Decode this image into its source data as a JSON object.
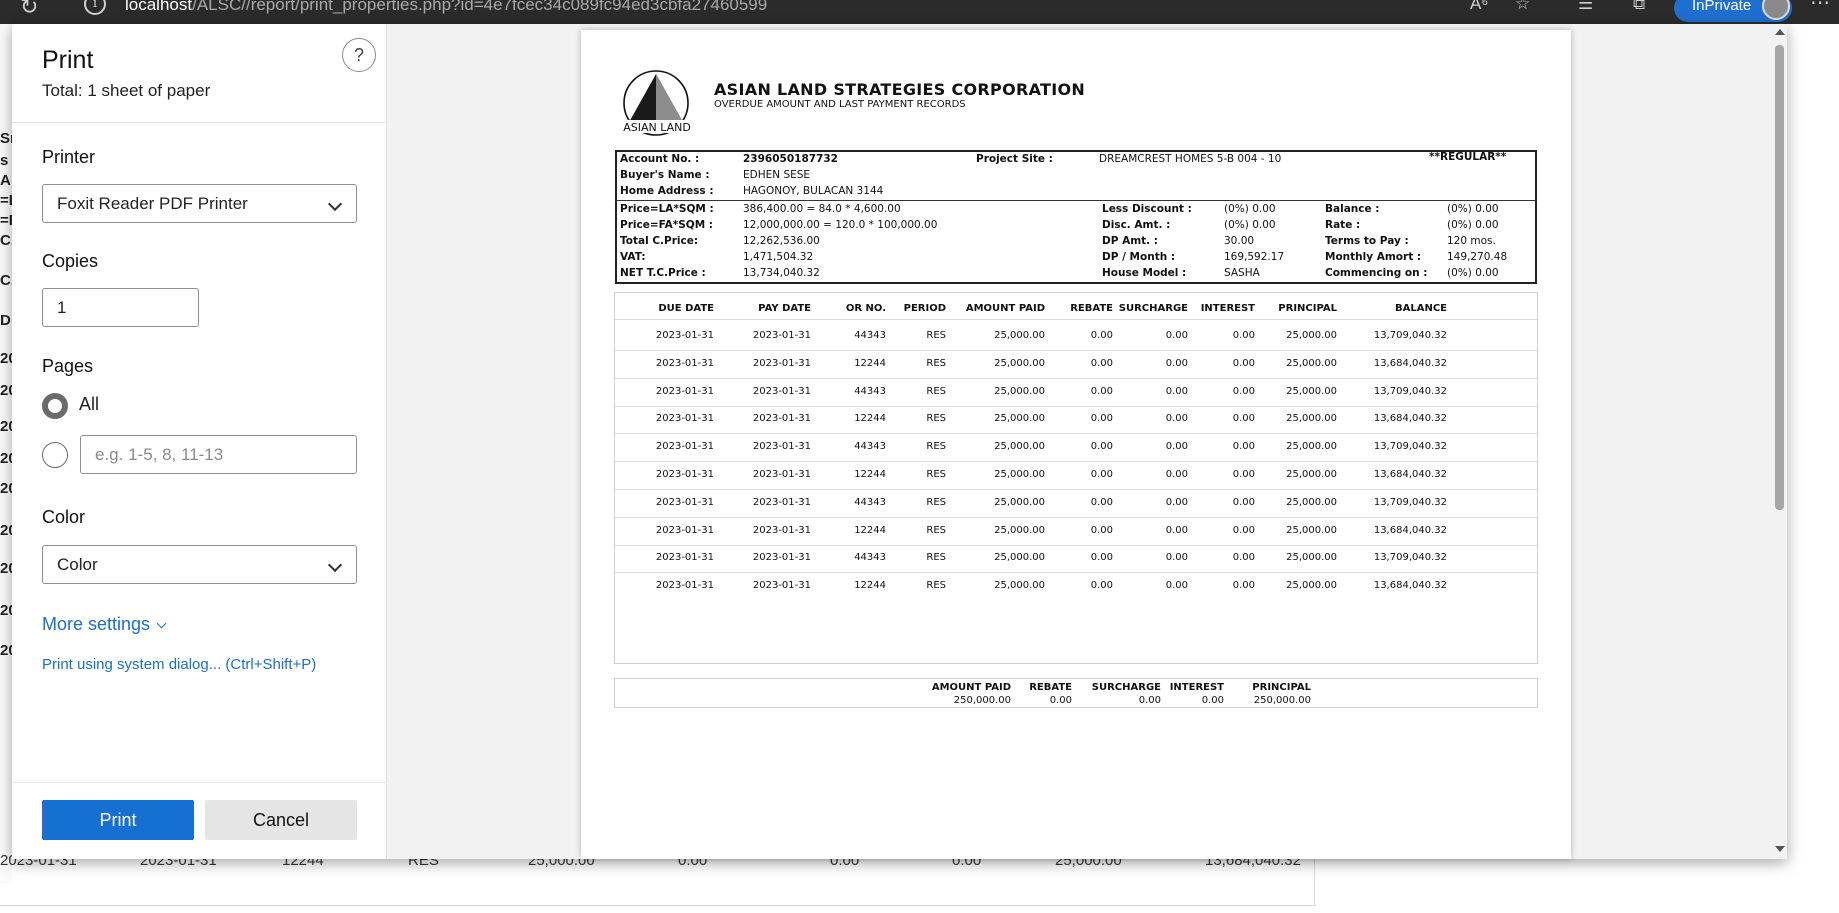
{
  "browser": {
    "url_host": "localhost",
    "url_path": "/ALSC//report/print_properties.php?id=4e7fcec34c089fc94ed3cbfa27460599",
    "inprivate_label": "InPrivate"
  },
  "background_page": {
    "left_fragments": [
      "Sn",
      "s",
      "A",
      "=L",
      "=F",
      "C.",
      "C.",
      "D",
      "20",
      "20",
      "20",
      "20",
      "20",
      "20",
      "20",
      "20",
      "20"
    ],
    "partial_row": [
      "2023-01-31",
      "2023-01-31",
      "12244",
      "RES",
      "25,000.00",
      "0.00",
      "0.00",
      "0.00",
      "25,000.00",
      "13,684,040.32"
    ]
  },
  "print_panel": {
    "title": "Print",
    "total": "Total: 1 sheet of paper",
    "help_icon": "?",
    "printer_label": "Printer",
    "printer_value": "Foxit Reader PDF Printer",
    "copies_label": "Copies",
    "copies_value": "1",
    "pages_label": "Pages",
    "pages_all": "All",
    "pages_placeholder": "e.g. 1-5, 8, 11-13",
    "color_label": "Color",
    "color_value": "Color",
    "more_settings": "More settings",
    "system_dialog": "Print using system dialog... (Ctrl+Shift+P)",
    "print_button": "Print",
    "cancel_button": "Cancel"
  },
  "report": {
    "company": "ASIAN LAND STRATEGIES CORPORATION",
    "subtitle": "OVERDUE AMOUNT AND LAST PAYMENT RECORDS",
    "logo_text": "ASIAN LAND",
    "account_label": "Account No. :",
    "account_value": "2396050187732",
    "project_label": "Project Site :",
    "project_value": "DREAMCREST HOMES 5-B 004 - 10",
    "regular_tag": "**REGULAR**",
    "buyer_label": "Buyer's Name :",
    "buyer_value": "EDHEN SESE",
    "address_label": "Home Address :",
    "address_value": "HAGONOY, BULACAN 3144",
    "price_la_label": "Price=LA*SQM :",
    "price_la_value": "386,400.00 = 84.0 * 4,600.00",
    "price_fa_label": "Price=FA*SQM :",
    "price_fa_value": "12,000,000.00 = 120.0 * 100,000.00",
    "total_cprice_label": "Total C.Price:",
    "total_cprice_value": "12,262,536.00",
    "vat_label": "VAT:",
    "vat_value": "1,471,504.32",
    "net_label": "NET T.C.Price :",
    "net_value": "13,734,040.32",
    "less_discount_label": "Less Discount :",
    "less_discount_value": "(0%) 0.00",
    "disc_amt_label": "Disc. Amt. :",
    "disc_amt_value": "(0%) 0.00",
    "dp_amt_label": "DP Amt. :",
    "dp_amt_value": "30.00",
    "dp_month_label": "DP / Month :",
    "dp_month_value": "169,592.17",
    "house_model_label": "House Model :",
    "house_model_value": "SASHA",
    "balance_label": "Balance :",
    "balance_value": "(0%) 0.00",
    "rate_label": "Rate :",
    "rate_value": "(0%) 0.00",
    "terms_label": "Terms to Pay :",
    "terms_value": "120 mos.",
    "monthly_label": "Monthly Amort :",
    "monthly_value": "149,270.48",
    "commencing_label": "Commencing on :",
    "commencing_value": "(0%) 0.00",
    "columns": [
      "DUE DATE",
      "PAY DATE",
      "OR NO.",
      "PERIOD",
      "AMOUNT PAID",
      "REBATE",
      "SURCHARGE",
      "INTEREST",
      "PRINCIPAL",
      "BALANCE"
    ],
    "rows": [
      [
        "2023-01-31",
        "2023-01-31",
        "44343",
        "RES",
        "25,000.00",
        "0.00",
        "0.00",
        "0.00",
        "25,000.00",
        "13,709,040.32"
      ],
      [
        "2023-01-31",
        "2023-01-31",
        "12244",
        "RES",
        "25,000.00",
        "0.00",
        "0.00",
        "0.00",
        "25,000.00",
        "13,684,040.32"
      ],
      [
        "2023-01-31",
        "2023-01-31",
        "44343",
        "RES",
        "25,000.00",
        "0.00",
        "0.00",
        "0.00",
        "25,000.00",
        "13,709,040.32"
      ],
      [
        "2023-01-31",
        "2023-01-31",
        "12244",
        "RES",
        "25,000.00",
        "0.00",
        "0.00",
        "0.00",
        "25,000.00",
        "13,684,040.32"
      ],
      [
        "2023-01-31",
        "2023-01-31",
        "44343",
        "RES",
        "25,000.00",
        "0.00",
        "0.00",
        "0.00",
        "25,000.00",
        "13,709,040.32"
      ],
      [
        "2023-01-31",
        "2023-01-31",
        "12244",
        "RES",
        "25,000.00",
        "0.00",
        "0.00",
        "0.00",
        "25,000.00",
        "13,684,040.32"
      ],
      [
        "2023-01-31",
        "2023-01-31",
        "44343",
        "RES",
        "25,000.00",
        "0.00",
        "0.00",
        "0.00",
        "25,000.00",
        "13,709,040.32"
      ],
      [
        "2023-01-31",
        "2023-01-31",
        "12244",
        "RES",
        "25,000.00",
        "0.00",
        "0.00",
        "0.00",
        "25,000.00",
        "13,684,040.32"
      ],
      [
        "2023-01-31",
        "2023-01-31",
        "44343",
        "RES",
        "25,000.00",
        "0.00",
        "0.00",
        "0.00",
        "25,000.00",
        "13,709,040.32"
      ],
      [
        "2023-01-31",
        "2023-01-31",
        "12244",
        "RES",
        "25,000.00",
        "0.00",
        "0.00",
        "0.00",
        "25,000.00",
        "13,684,040.32"
      ]
    ],
    "totals_columns": [
      "AMOUNT PAID",
      "REBATE",
      "SURCHARGE",
      "INTEREST",
      "PRINCIPAL"
    ],
    "totals_values": [
      "250,000.00",
      "0.00",
      "0.00",
      "0.00",
      "250,000.00"
    ]
  },
  "colors": {
    "accent": "#1570d2",
    "link": "#1a6fc8",
    "topbar": "#2b2b2b",
    "preview_bg": "#f2f2f2"
  },
  "icons": [
    "refresh-icon",
    "info-icon",
    "read-aloud-icon",
    "favorite-add-icon",
    "favorites-icon",
    "collections-icon",
    "profile-avatar",
    "more-icon",
    "help-icon",
    "chevron-down-icon"
  ]
}
